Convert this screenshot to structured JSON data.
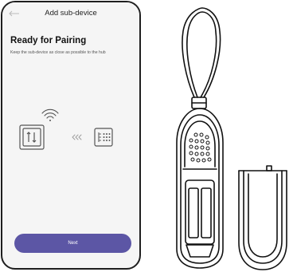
{
  "header": {
    "title": "Add sub-device"
  },
  "main": {
    "title": "Ready for Pairing",
    "subtitle": "Keep the sub-device as close as possible to the hub"
  },
  "footer": {
    "next_label": "Next"
  },
  "icons": {
    "back": "back-arrow-icon",
    "hub": "hub-icon",
    "wifi": "wifi-icon",
    "chevrons": "chevrons-left-icon",
    "sub_device": "sub-device-icon"
  },
  "colors": {
    "accent": "#5c56a5",
    "background": "#f5f5f5",
    "icon_stroke": "#555555"
  }
}
